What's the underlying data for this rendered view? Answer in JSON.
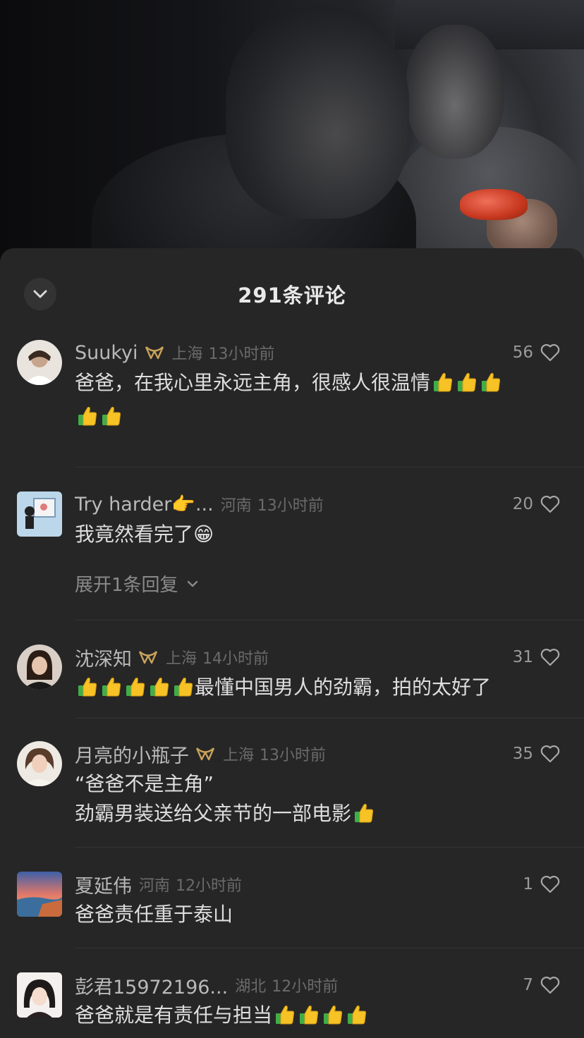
{
  "sheet": {
    "title": "291条评论"
  },
  "comments": [
    {
      "username": "Suukyi",
      "vip": true,
      "location": "上海",
      "time": "13小时前",
      "likes": "56",
      "lines": [
        "爸爸，在我心里永远主角，很感人很温情",
        ""
      ],
      "thumbs": [
        3,
        2
      ]
    },
    {
      "username": "Try harder👉...",
      "vip": false,
      "location": "河南",
      "time": "13小时前",
      "likes": "20",
      "lines": [
        "我竟然看完了😁"
      ],
      "expand_label": "展开1条回复"
    },
    {
      "username": "沈深知",
      "vip": true,
      "location": "上海",
      "time": "14小时前",
      "likes": "31",
      "lines": [
        "最懂中国男人的劲霸，拍的太好了"
      ],
      "thumbs_prefix": 5
    },
    {
      "username": "月亮的小瓶子",
      "vip": true,
      "location": "上海",
      "time": "13小时前",
      "likes": "35",
      "lines": [
        "“爸爸不是主角”",
        "劲霸男装送给父亲节的一部电影"
      ],
      "thumbs": [
        0,
        1
      ]
    },
    {
      "username": "夏延伟",
      "vip": false,
      "location": "河南",
      "time": "12小时前",
      "likes": "1",
      "lines": [
        "爸爸责任重于泰山"
      ]
    },
    {
      "username": "彭君15972196...",
      "vip": false,
      "location": "湖北",
      "time": "12小时前",
      "likes": "7",
      "lines": [
        "爸爸就是有责任与担当"
      ],
      "thumbs": [
        4
      ]
    }
  ],
  "colors": {
    "sheet_bg": "#262626",
    "text_primary": "#dedede",
    "text_secondary": "#b9b9b9",
    "vip_gold": "#c9a35a"
  },
  "icons": {
    "collapse": "chevron-down-icon",
    "like": "heart-outline-icon",
    "vip": "vip-badge-icon",
    "thumbs": "thumbs-up-emoji"
  }
}
